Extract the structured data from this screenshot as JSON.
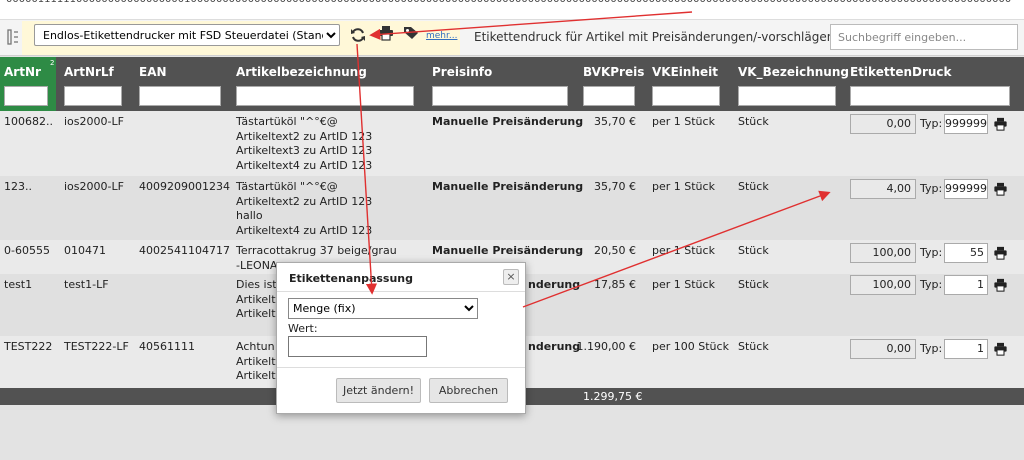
{
  "url": "00000111111000000000000000001000000000000000000000000000000000000000000000000000000000000000000000000000000000000000000000000000000000000000000000000000000000",
  "toolbar": {
    "printer_selected": "Endlos-Etikettendrucker mit FSD Steuerdatei (Standard)",
    "more_link": "mehr...",
    "title": "Etikettendruck für Artikel mit Preisänderungen/-vorschlägen...",
    "search_placeholder": "Suchbegriff eingeben...",
    "icons": [
      "config-icon",
      "refresh-icon",
      "printer-icon",
      "tag-icon"
    ]
  },
  "table": {
    "sort_badge": "2",
    "columns": [
      "ArtNr",
      "ArtNrLf",
      "EAN",
      "Artikelbezeichnung",
      "Preisinfo",
      "BVKPreis",
      "VKEinheit",
      "VK_Bezeichnung",
      "EtikettenDruck"
    ],
    "typ_label": "Typ:",
    "rows": [
      {
        "artnr": "100682..",
        "artnrlf": "ios2000-LF",
        "ean": "",
        "desc": [
          "Tästartüköl \"^°€@",
          "Artikeltext2 zu ArtID 123",
          "Artikeltext3 zu ArtID 123",
          "Artikeltext4 zu ArtID 123"
        ],
        "preisinfo": "Manuelle Preisänderung",
        "bvk": "35,70 €",
        "vke": "per 1 Stück",
        "vkb": "Stück",
        "qty": "0,00",
        "typ": "999999"
      },
      {
        "artnr": "123..",
        "artnrlf": "ios2000-LF",
        "ean": "4009209001234",
        "desc": [
          "Tästartüköl \"^°€@",
          "Artikeltext2 zu ArtID 123",
          "hallo",
          "Artikeltext4 zu ArtID 123"
        ],
        "preisinfo": "Manuelle Preisänderung",
        "bvk": "35,70 €",
        "vke": "per 1 Stück",
        "vkb": "Stück",
        "qty": "4,00",
        "typ": "999999"
      },
      {
        "artnr": "0-60555",
        "artnrlf": "010471",
        "ean": "4002541104717",
        "desc": [
          "Terracottakrug 37 beige/grau",
          "-LEONA"
        ],
        "preisinfo": "Manuelle Preisänderung",
        "bvk": "20,50 €",
        "vke": "per 1 Stück",
        "vkb": "Stück",
        "qty": "100,00",
        "typ": "55"
      },
      {
        "artnr": "test1",
        "artnrlf": "test1-LF",
        "ean": "",
        "desc": [
          "Dies ist",
          "Artikelt",
          "Artikelt"
        ],
        "preisinfo": "nderung",
        "bvk": "17,85 €",
        "vke": "per 1 Stück",
        "vkb": "Stück",
        "qty": "100,00",
        "typ": "1"
      },
      {
        "artnr": "TEST222",
        "artnrlf": "TEST222-LF",
        "ean": "40561111",
        "desc": [
          "Achtun",
          "Artikelt",
          "Artikelt"
        ],
        "preisinfo": "nderung",
        "bvk": "1.190,00 €",
        "vke": "per 100 Stück",
        "vkb": "Stück",
        "qty": "0,00",
        "typ": "1"
      }
    ],
    "total": "1.299,75 €"
  },
  "dialog": {
    "title": "Etikettenanpassung",
    "close": "×",
    "select_value": "Menge (fix)",
    "wert_label": "Wert:",
    "apply_button": "Jetzt ändern!",
    "cancel_button": "Abbrechen"
  },
  "colors": {
    "header_bg": "#525252",
    "sort_active": "#2e8b45",
    "toolbar_highlight": "#fff8d8",
    "annotation_arrow": "#e03030",
    "link": "#336fbf"
  }
}
